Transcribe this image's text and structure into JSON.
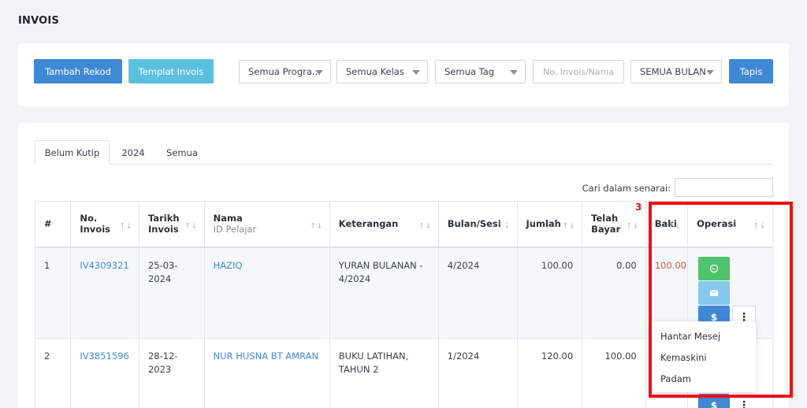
{
  "page_title": "INVOIS",
  "filters": {
    "add_button": "Tambah Rekod",
    "template_button": "Templat Invois",
    "program_select": "Semua Progra...",
    "class_select": "Semua Kelas",
    "tag_select": "Semua Tag",
    "invoice_search_placeholder": "No. Invois/Nama",
    "month_select": "SEMUA BULAN",
    "filter_button": "Tapis"
  },
  "tabs": [
    {
      "label": "Belum Kutip",
      "active": true
    },
    {
      "label": "2024",
      "active": false
    },
    {
      "label": "Semua",
      "active": false
    }
  ],
  "search_label": "Cari dalam senarai:",
  "table": {
    "columns": {
      "index": "#",
      "invoice_no_1": "No.",
      "invoice_no_2": "Invois",
      "date_1": "Tarikh",
      "date_2": "Invois",
      "name_1": "Nama",
      "name_2": "ID Pelajar",
      "description": "Keterangan",
      "month": "Bulan/Sesi",
      "amount": "Jumlah",
      "paid_1": "Telah",
      "paid_2": "Bayar",
      "balance": "Baki",
      "operations": "Operasi"
    },
    "rows": [
      {
        "index": "1",
        "invoice_no": "IV4309321",
        "date_1": "25-03-",
        "date_2": "2024",
        "name": "HAZIQ",
        "desc_1": "YURAN BULANAN -",
        "desc_2": "4/2024",
        "month": "4/2024",
        "amount": "100.00",
        "paid": "0.00",
        "balance": "100.00"
      },
      {
        "index": "2",
        "invoice_no": "IV3851596",
        "date_1": "28-12-",
        "date_2": "2023",
        "name": "NUR HUSNA BT AMRAN",
        "desc_1": "BUKU LATIHAN,",
        "desc_2": "TAHUN 2",
        "month": "1/2024",
        "amount": "120.00",
        "paid": "100.00",
        "balance": ""
      }
    ]
  },
  "dropdown_menu": [
    "Hantar Mesej",
    "Kemaskini",
    "Padam"
  ],
  "highlight_label": "3",
  "icons": {
    "whatsapp": "whatsapp-icon",
    "email": "email-icon",
    "payment": "dollar-icon",
    "more": "kebab-icon"
  },
  "colors": {
    "primary": "#3f88d6",
    "cyan": "#5bc0de",
    "green": "#4cc46c",
    "danger": "#e74c3c",
    "highlight": "#ef1111"
  }
}
